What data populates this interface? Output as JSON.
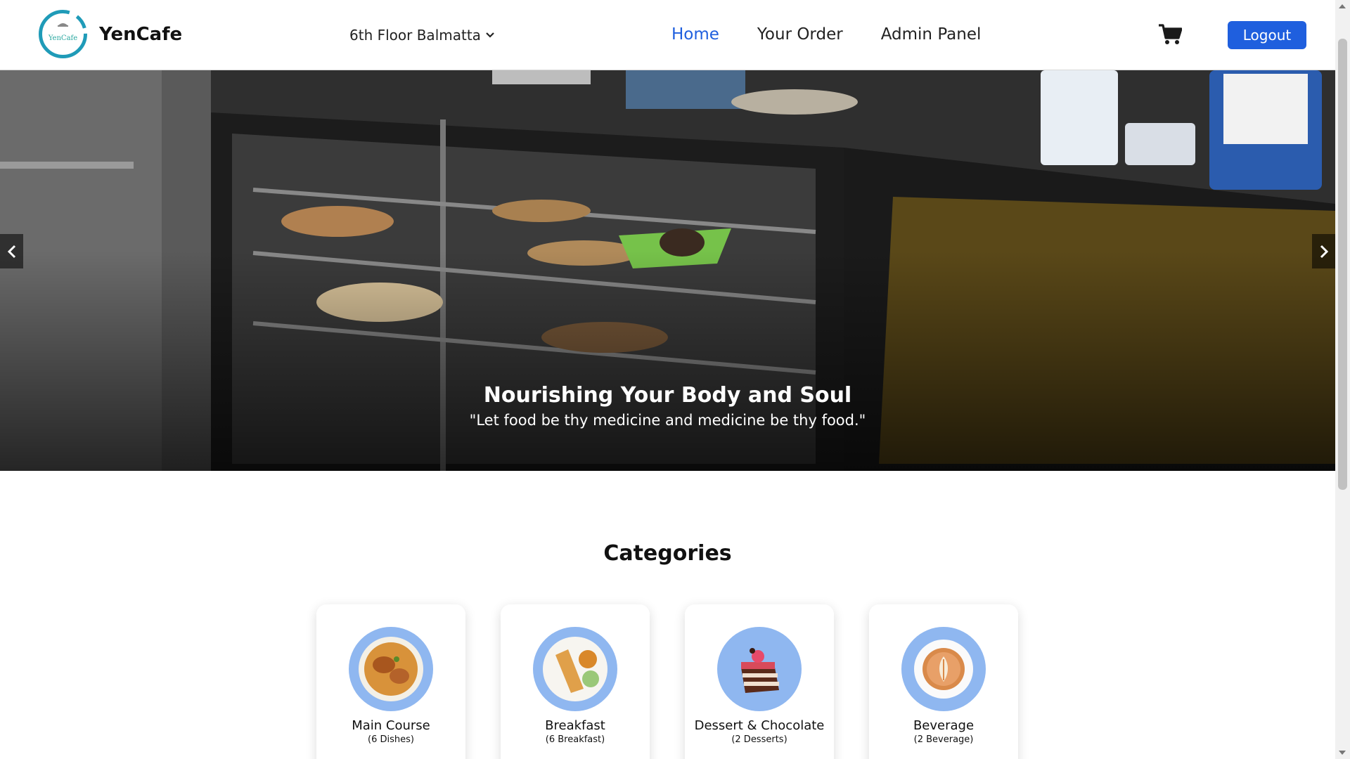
{
  "header": {
    "brand_name": "YenCafe",
    "logo_text": "YenCafe",
    "location": "6th Floor Balmatta",
    "nav": [
      {
        "label": "Home",
        "active": true
      },
      {
        "label": "Your Order",
        "active": false
      },
      {
        "label": "Admin Panel",
        "active": false
      }
    ],
    "logout_label": "Logout",
    "accent_color": "#1f5fde"
  },
  "hero": {
    "title": "Nourishing Your Body and Soul",
    "quote": "\"Let food be thy medicine and medicine be thy food.\""
  },
  "categories": {
    "title": "Categories",
    "items": [
      {
        "name": "Main Course",
        "count": "(6 Dishes)",
        "icon": "biryani-icon"
      },
      {
        "name": "Breakfast",
        "count": "(6 Breakfast)",
        "icon": "dosa-icon"
      },
      {
        "name": "Dessert & Chocolate",
        "count": "(2 Desserts)",
        "icon": "cake-icon"
      },
      {
        "name": "Beverage",
        "count": "(2 Beverage)",
        "icon": "coffee-icon"
      }
    ]
  }
}
